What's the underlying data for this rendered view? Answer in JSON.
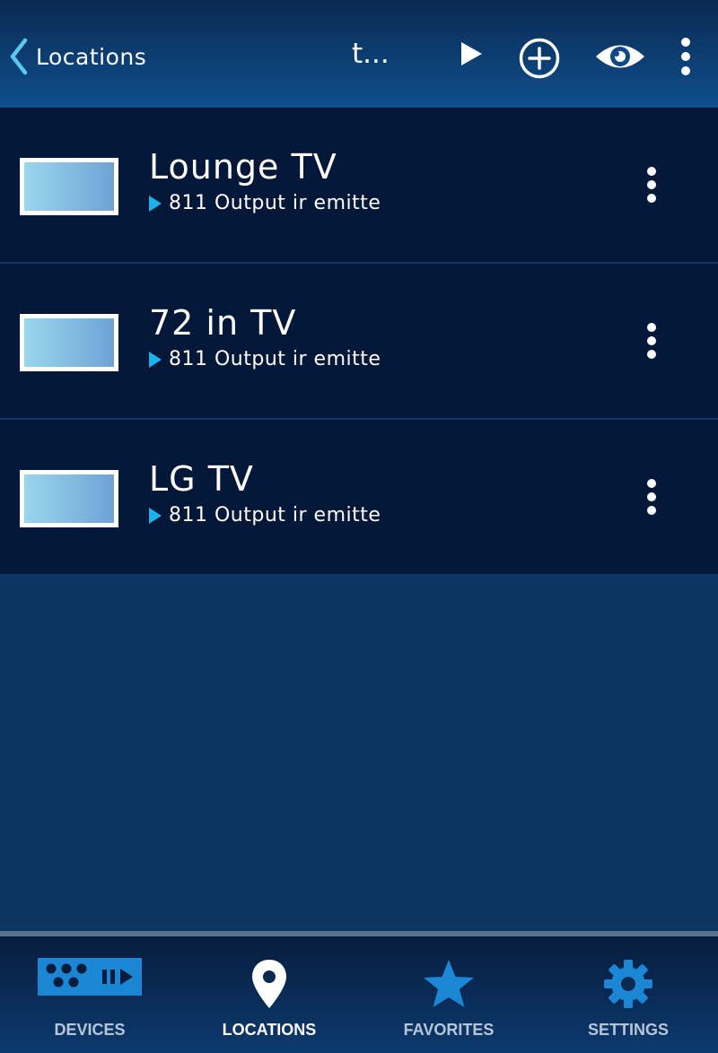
{
  "header": {
    "back_label": "Locations",
    "title": "t..."
  },
  "devices": [
    {
      "name": "Lounge TV",
      "source": "811 Output ir emitte"
    },
    {
      "name": "72 in TV",
      "source": "811 Output ir emitte"
    },
    {
      "name": "LG TV",
      "source": "811 Output ir emitte"
    }
  ],
  "nav": {
    "items": [
      {
        "label": "DEVICES",
        "icon": "devices-icon"
      },
      {
        "label": "LOCATIONS",
        "icon": "location-pin-icon"
      },
      {
        "label": "FAVORITES",
        "icon": "star-icon"
      },
      {
        "label": "SETTINGS",
        "icon": "gear-icon"
      }
    ],
    "active": "LOCATIONS"
  },
  "colors": {
    "background": "#0b3563",
    "row_background": "#031838",
    "accent": "#1ab3ea",
    "nav_icon_blue": "#1b87d4"
  }
}
